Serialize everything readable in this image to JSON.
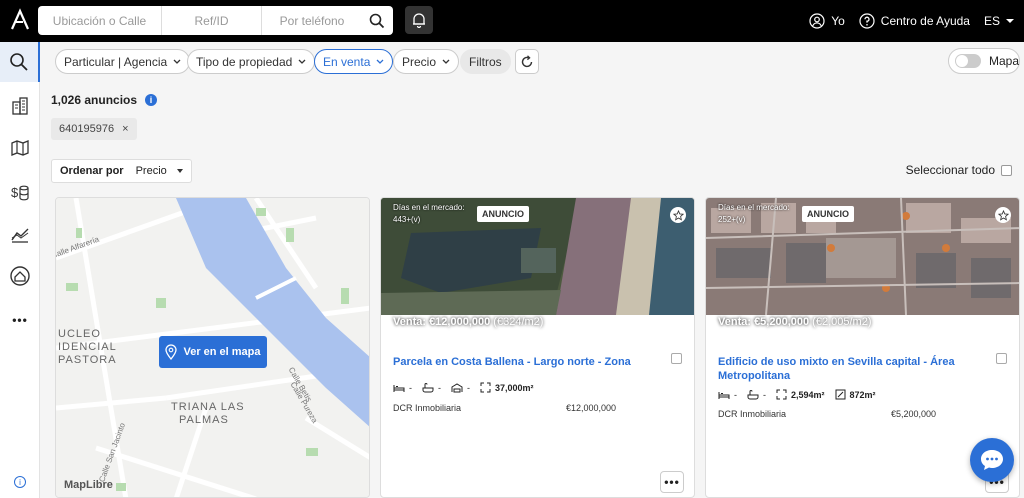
{
  "header": {
    "search": {
      "location_placeholder": "Ubicación o Calle",
      "ref_placeholder": "Ref/ID",
      "phone_placeholder": "Por teléfono"
    },
    "user_label": "Yo",
    "help_label": "Centro de Ayuda",
    "language": "ES"
  },
  "sidebar": {
    "items": [
      "search-icon",
      "building-icon",
      "map-icon",
      "money-stack-icon",
      "chart-icon",
      "home-pin-icon",
      "more-icon",
      "info-icon"
    ],
    "more_label": "•••",
    "info_label": "i"
  },
  "filters": {
    "seller_type": "Particular | Agencia",
    "property_type": "Tipo de propiedad",
    "operation": "En venta",
    "price": "Precio",
    "more_filters": "Filtros",
    "map_toggle_label": "Mapa"
  },
  "results": {
    "count_label": "1,026 anuncios",
    "info_icon": "i",
    "active_tag": "640195976",
    "tag_close": "×",
    "sort_label": "Ordenar por",
    "sort_value": "Precio",
    "select_all_label": "Seleccionar todo"
  },
  "map": {
    "button_label": "Ver en el mapa",
    "labels": [
      "UCLEO",
      "IDENCIAL",
      "PASTORA",
      "TRIANA LAS",
      "PALMAS"
    ],
    "street_labels": [
      "Calle Alfarería",
      "Calle Betis",
      "Calle Pureza",
      "Calle San Jacinto"
    ],
    "attribution": "MapLibre"
  },
  "listings": [
    {
      "days_label": "Días en el mercado: 443+(v)",
      "badge": "ANUNCIO",
      "price_overlay_bold": "Venta: €12,000,000",
      "price_overlay_sub": " (€324/m2)",
      "title": "Parcela en Costa Ballena - Largo norte - Zona",
      "beds": "-",
      "baths": "-",
      "garage": "-",
      "plot_area": "37,000m²",
      "built_area": "",
      "agency": "DCR Inmobiliaria",
      "price": "€12,000,000",
      "more": "•••"
    },
    {
      "days_label": "Días en el mercado: 252+(v)",
      "badge": "ANUNCIO",
      "price_overlay_bold": "Venta: €5,200,000",
      "price_overlay_sub": " (€2,005/m2)",
      "title": "Edificio de uso mixto en Sevilla capital - Área Metropolitana",
      "beds": "-",
      "baths": "-",
      "garage": "",
      "plot_area": "2,594m²",
      "built_area": "872m²",
      "agency": "DCR Inmobiliaria",
      "price": "€5,200,000",
      "more": "•••"
    }
  ],
  "colors": {
    "accent": "#2b6fd6",
    "topbar": "#000000",
    "river": "#aac2ee"
  }
}
